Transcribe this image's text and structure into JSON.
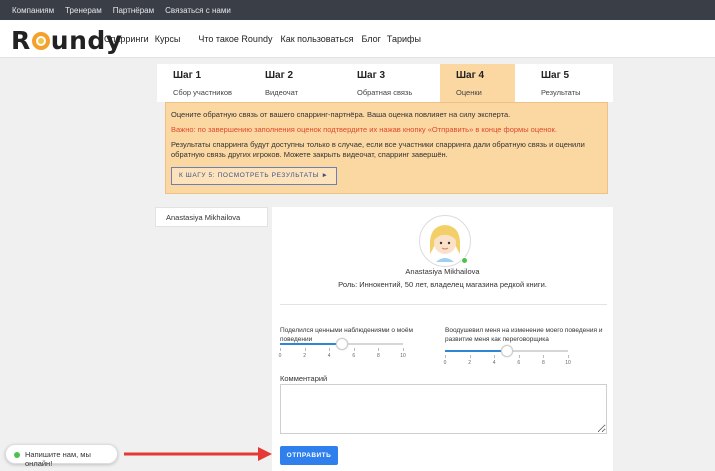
{
  "topbar": {
    "links": [
      "Компаниям",
      "Тренерам",
      "Партнёрам",
      "Связаться с нами"
    ]
  },
  "header": {
    "logo": "Roundy",
    "nav": [
      "Спарринги",
      "Курсы",
      "Что такое Roundy",
      "Как пользоваться",
      "Блог",
      "Тарифы"
    ]
  },
  "steps": [
    {
      "title": "Шаг 1",
      "sub": "Сбор участников",
      "active": false
    },
    {
      "title": "Шаг 2",
      "sub": "Видеочат",
      "active": false
    },
    {
      "title": "Шаг 3",
      "sub": "Обратная связь",
      "active": false
    },
    {
      "title": "Шаг 4",
      "sub": "Оценки",
      "active": true
    },
    {
      "title": "Шаг 5",
      "sub": "Результаты",
      "active": false
    }
  ],
  "notice": {
    "p1": "Оцените обратную связь от вашего спарринг-партнёра. Ваша оценка повлияет на силу эксперта.",
    "p2": "Важно: по завершению заполнения оценок подтвердите их нажав кнопку «Отправить» в конце формы оценок.",
    "p3": "Результаты спарринга будут доступны только в случае, если все участники спарринга дали обратную связь и оценили обратную связь других игроков. Можете закрыть видеочат, спарринг завершён.",
    "button": "К ШАГУ 5: ПОСМОТРЕТЬ РЕЗУЛЬТАТЫ ►"
  },
  "participant_tab": "Anastasiya Mikhailova",
  "profile": {
    "name": "Anastasiya Mikhailova",
    "role": "Роль: Иннокентий, 50 лет, владелец магазина редкой книги."
  },
  "sliders": [
    {
      "label": "Поделился ценными наблюдениями о моём поведении",
      "value": 5,
      "min": 0,
      "max": 10,
      "ticks": [
        "0",
        "2",
        "4",
        "6",
        "8",
        "10"
      ]
    },
    {
      "label": "Воодушевил меня на изменение моего поведения и развитие меня как переговорщика",
      "value": 5,
      "min": 0,
      "max": 10,
      "ticks": [
        "0",
        "2",
        "4",
        "6",
        "8",
        "10"
      ]
    }
  ],
  "comment": {
    "label": "Комментарий",
    "value": ""
  },
  "submit": "ОТПРАВИТЬ",
  "chat_widget": "Напишите нам, мы онлайн!",
  "colors": {
    "accent": "#2f80ed",
    "notice_bg": "#fbd7a2",
    "warning": "#e04a2b",
    "arrow": "#e53935",
    "online": "#4cc24c"
  }
}
